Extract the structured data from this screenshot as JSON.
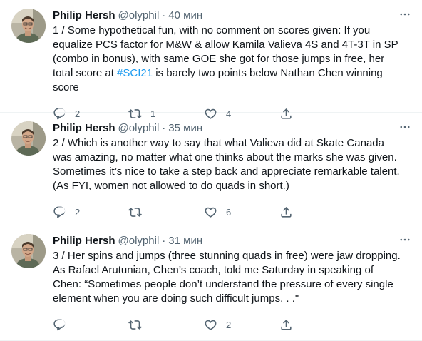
{
  "colors": {
    "text": "#0f1419",
    "secondary": "#536471",
    "link": "#1d9bf0",
    "divider": "#eff3f4"
  },
  "icons": {
    "reply": "reply-icon",
    "retweet": "retweet-icon",
    "like": "like-icon",
    "share": "share-icon",
    "more": "more-icon"
  },
  "tweets": [
    {
      "name": "Philip Hersh",
      "handle": "@olyphil",
      "dot": "·",
      "time": "40 мин",
      "text_before": "1 / Some hypothetical fun, with no comment on scores given: If you equalize PCS factor for M&W & allow Kamila Valieva 4S and 4T-3T in SP (combo in bonus), with same GOE she got for those jumps in free, her total score at ",
      "hashtag": "#SCI21",
      "text_after": " is barely two points below Nathan Chen winning score",
      "replies": "2",
      "retweets": "1",
      "likes": "4"
    },
    {
      "name": "Philip Hersh",
      "handle": "@olyphil",
      "dot": "·",
      "time": "35 мин",
      "text_before": "2 / Which is another way to say that what Valieva did at Skate Canada was amazing, no matter what one thinks about the marks she was given. Sometimes it’s nice to take a step back and appreciate remarkable talent. (As FYI, women not allowed to do quads in short.)",
      "hashtag": "",
      "text_after": "",
      "replies": "2",
      "retweets": "",
      "likes": "6"
    },
    {
      "name": "Philip Hersh",
      "handle": "@olyphil",
      "dot": "·",
      "time": "31 мин",
      "text_before": "3 / Her spins and jumps (three stunning quads in free) were jaw dropping. As Rafael Arutunian, Chen’s coach, told me Saturday in speaking of Chen: “Sometimes people don’t understand the pressure of every single element when you are doing such difficult jumps. . .\"",
      "hashtag": "",
      "text_after": "",
      "replies": "",
      "retweets": "",
      "likes": "2"
    }
  ]
}
